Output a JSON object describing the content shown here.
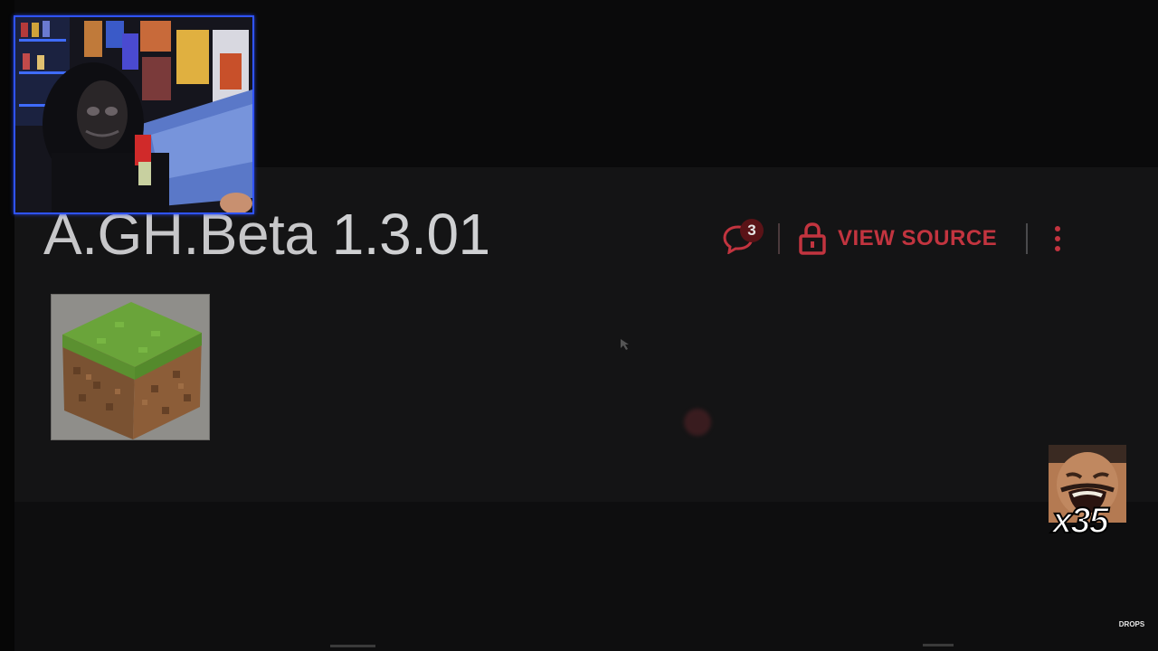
{
  "page": {
    "title_prefix": "A.GH.Beta",
    "title_version": "1.3.01"
  },
  "toolbar": {
    "comment_count": "3",
    "view_source_label": "VIEW SOURCE"
  },
  "icons": {
    "comments": "speech-bubble-icon",
    "lock": "lock-icon",
    "more": "kebab-menu-icon"
  },
  "overlay": {
    "meme_counter": "x35",
    "watermark": "DROPS"
  },
  "colors": {
    "accent": "#c2343f",
    "webcam_border": "#2f53ff",
    "background": "#141415"
  }
}
